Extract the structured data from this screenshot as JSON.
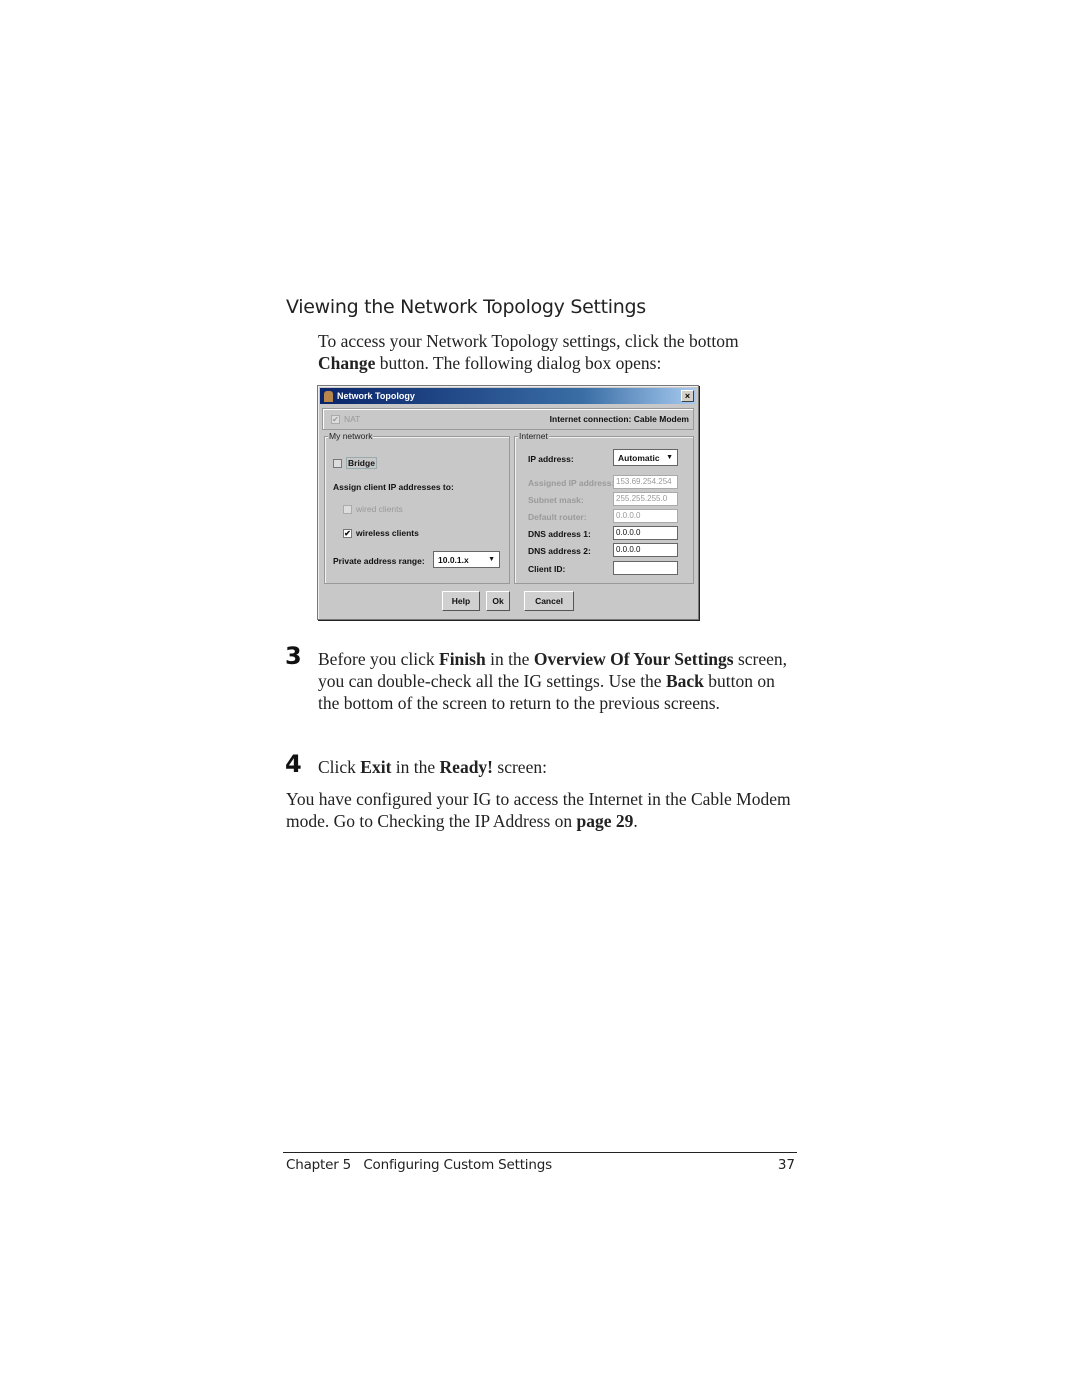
{
  "section_title": "Viewing the Network Topology Settings",
  "intro": {
    "part1": "To access your Network Topology settings, click the bottom ",
    "bold1": "Change",
    "part2": " button. The following dialog box opens:"
  },
  "dialog": {
    "title": "Network Topology",
    "close_icon": "close-icon",
    "nat_label": "NAT",
    "nat_checked": true,
    "internet_connection": "Internet connection: Cable Modem",
    "my_network": {
      "group_label": "My network",
      "bridge_label": "Bridge",
      "bridge_checked": false,
      "assign_label": "Assign client IP addresses to:",
      "wired_label": "wired clients",
      "wired_checked": false,
      "wireless_label": "wireless clients",
      "wireless_checked": true,
      "range_label": "Private address range:",
      "range_value": "10.0.1.x"
    },
    "internet": {
      "group_label": "Internet",
      "ip_address_label": "IP address:",
      "ip_address_mode": "Automatic",
      "assigned_ip_label": "Assigned IP address:",
      "assigned_ip_value": "153.69.254.254",
      "subnet_label": "Subnet mask:",
      "subnet_value": "255.255.255.0",
      "router_label": "Default router:",
      "router_value": "0.0.0.0",
      "dns1_label": "DNS address 1:",
      "dns1_value": "0.0.0.0",
      "dns2_label": "DNS address 2:",
      "dns2_value": "0.0.0.0",
      "client_id_label": "Client ID:",
      "client_id_value": ""
    },
    "buttons": {
      "help": "Help",
      "ok": "Ok",
      "cancel": "Cancel"
    },
    "check_mark": "✔",
    "arrow": "▼"
  },
  "step3": {
    "number": "3",
    "t1": "Before you click ",
    "b1": "Finish",
    "t2": " in the ",
    "b2": "Overview Of Your Settings",
    "t3": " screen, you can double-check all the IG settings. Use the ",
    "b3": "Back",
    "t4": " button on the bottom of the screen to return to the previous screens."
  },
  "step4": {
    "number": "4",
    "t1": "Click ",
    "b1": "Exit",
    "t2": " in the ",
    "b2": "Ready!",
    "t3": " screen:"
  },
  "closing": {
    "t1": "You have configured your IG to access the Internet in the Cable Modem mode. Go to Checking the IP Address on ",
    "b1": "page 29",
    "t2": "."
  },
  "footer": {
    "chapter": "Chapter 5   Configuring Custom Settings",
    "page": "37"
  }
}
